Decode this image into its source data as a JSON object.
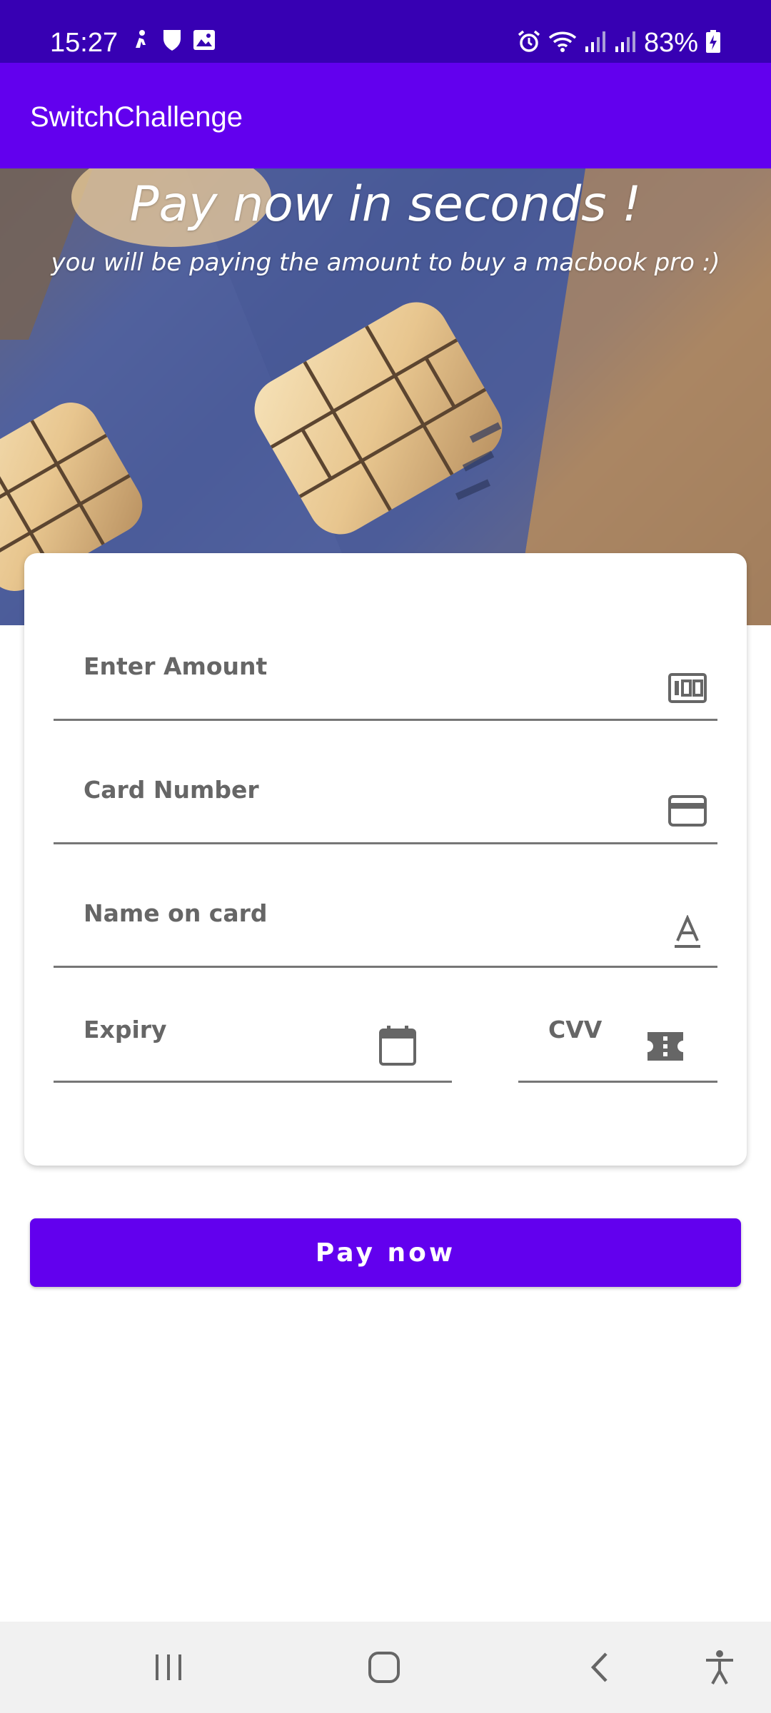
{
  "status_bar": {
    "time": "15:27",
    "battery": "83%",
    "left_icons": [
      "notification-figure-icon",
      "shield-icon",
      "image-icon"
    ],
    "right_icons": [
      "alarm-icon",
      "wifi-icon",
      "signal-icon",
      "signal-icon",
      "battery-charging-icon"
    ]
  },
  "app_bar": {
    "title": "SwitchChallenge"
  },
  "hero": {
    "title": "Pay now in seconds !",
    "subtitle": "you will be paying the amount to buy a macbook pro :)"
  },
  "form": {
    "amount": {
      "placeholder": "Enter Amount",
      "icon": "money-icon"
    },
    "card_number": {
      "placeholder": "Card Number",
      "icon": "credit-card-icon"
    },
    "name_on_card": {
      "placeholder": "Name on card",
      "icon": "text-format-icon"
    },
    "expiry": {
      "placeholder": "Expiry",
      "icon": "calendar-icon"
    },
    "cvv": {
      "placeholder": "CVV",
      "icon": "ticket-icon"
    }
  },
  "pay_button": {
    "label": "Pay now"
  },
  "nav_bar": {
    "buttons": [
      "recent-apps-icon",
      "home-icon",
      "back-icon",
      "accessibility-icon"
    ]
  },
  "colors": {
    "status_bar": "#3700b3",
    "primary": "#6200ee",
    "field_label": "#666666",
    "underline": "#767676"
  }
}
